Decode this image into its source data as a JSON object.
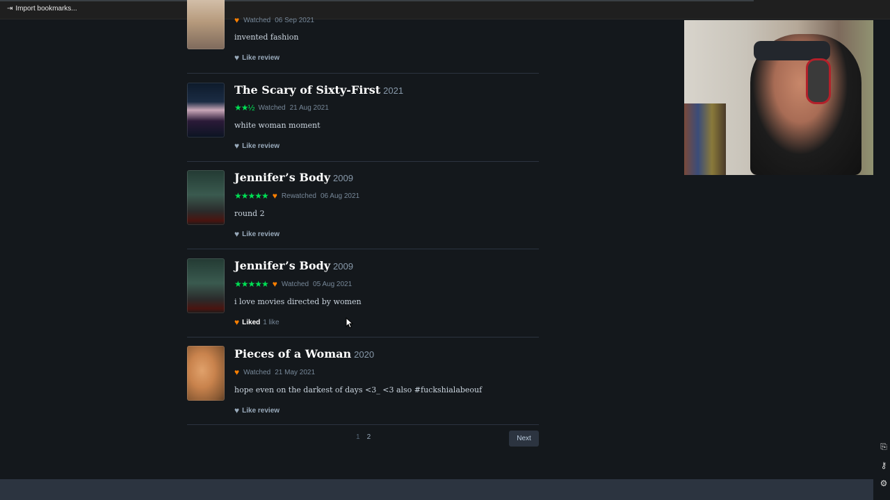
{
  "bookmarks_bar": {
    "import_label": "Import bookmarks..."
  },
  "reviews": [
    {
      "partial": true,
      "meta": {
        "liked_heart": true,
        "status": "Watched",
        "date": "06 Sep 2021"
      },
      "text": "invented fashion",
      "like": {
        "label": "Like review",
        "liked": false
      }
    },
    {
      "title": "The Scary of Sixty-First",
      "year": "2021",
      "meta": {
        "stars": "★★½",
        "status": "Watched",
        "date": "21 Aug 2021"
      },
      "text": "white woman moment",
      "like": {
        "label": "Like review",
        "liked": false
      }
    },
    {
      "title": "Jennifer’s Body",
      "year": "2009",
      "meta": {
        "stars": "★★★★★",
        "liked_heart": true,
        "status": "Rewatched",
        "date": "06 Aug 2021"
      },
      "text": "round 2",
      "like": {
        "label": "Like review",
        "liked": false
      }
    },
    {
      "title": "Jennifer’s Body",
      "year": "2009",
      "meta": {
        "stars": "★★★★★",
        "liked_heart": true,
        "status": "Watched",
        "date": "05 Aug 2021"
      },
      "text": "i love movies directed by women",
      "like": {
        "label": "Liked",
        "liked": true,
        "count": "1 like"
      }
    },
    {
      "title": "Pieces of a Woman",
      "year": "2020",
      "meta": {
        "liked_heart": true,
        "status": "Watched",
        "date": "21 May 2021"
      },
      "text": "hope even on the darkest of days <3_ <3 also #fuckshialabeouf",
      "like": {
        "label": "Like review",
        "liked": false
      }
    }
  ],
  "pagination": {
    "pages": [
      "1",
      "2"
    ],
    "current": "1",
    "next_label": "Next"
  },
  "colors": {
    "background": "#14181c",
    "star_green": "#00e054",
    "heart_orange": "#ff8000"
  }
}
